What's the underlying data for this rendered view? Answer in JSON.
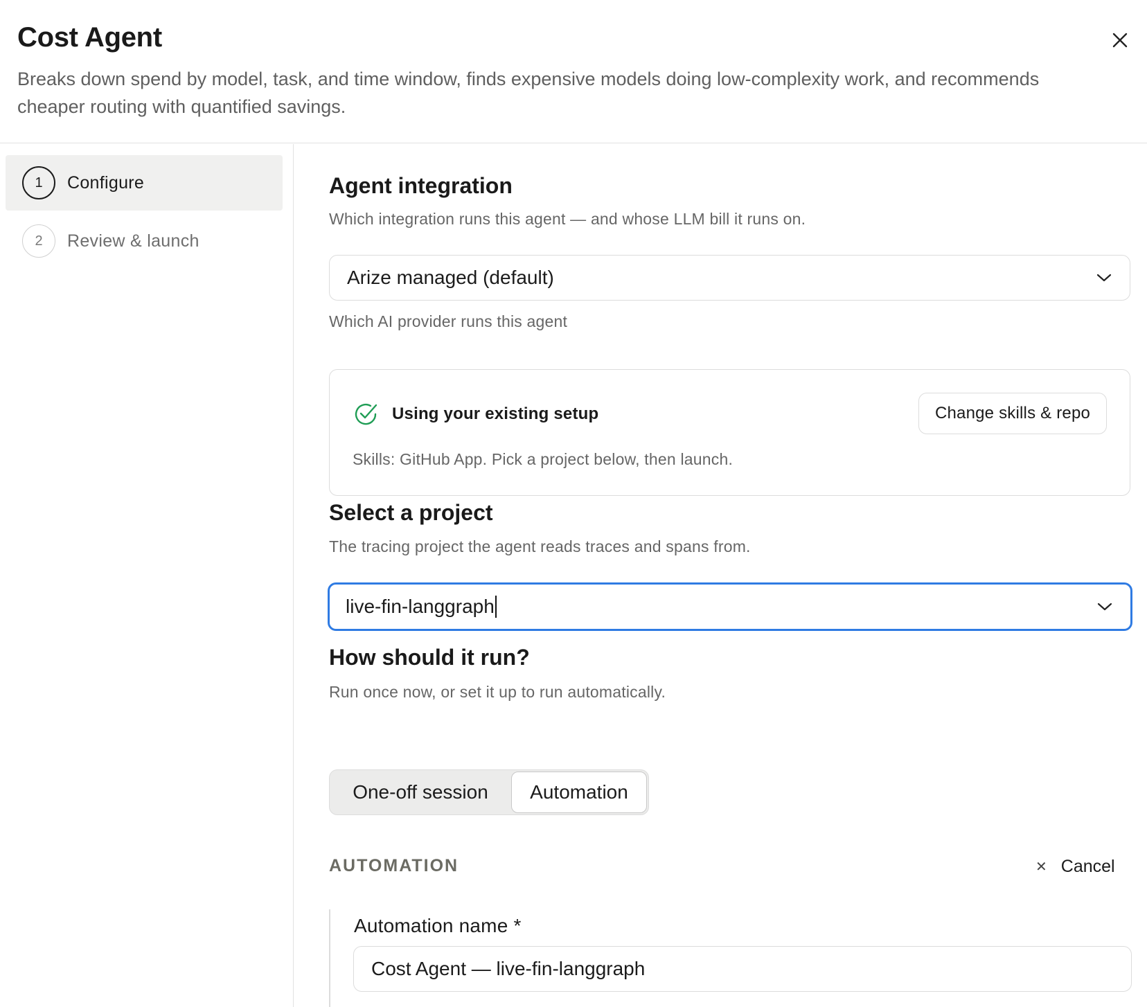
{
  "header": {
    "title": "Cost Agent",
    "subtitle": "Breaks down spend by model, task, and time window, finds expensive models doing low-complexity work, and recommends cheaper routing with quantified savings.",
    "close_icon": "close-icon"
  },
  "sidebar": {
    "steps": [
      {
        "number": "1",
        "label": "Configure",
        "active": true
      },
      {
        "number": "2",
        "label": "Review & launch",
        "active": false
      }
    ]
  },
  "integration": {
    "heading": "Agent integration",
    "description": "Which integration runs this agent — and whose LLM bill it runs on.",
    "selected": "Arize managed (default)",
    "help": "Which AI provider runs this agent"
  },
  "setup": {
    "title": "Using your existing setup",
    "note": "Skills: GitHub App. Pick a project below, then launch.",
    "change_button": "Change skills & repo",
    "status_color": "#1f9d55"
  },
  "project": {
    "heading": "Select a project",
    "description": "The tracing project the agent reads traces and spans from.",
    "value": "live-fin-langgraph",
    "focus_color": "#2f7be3"
  },
  "run": {
    "heading": "How should it run?",
    "description": "Run once now, or set it up to run automatically.",
    "options": [
      "One-off session",
      "Automation"
    ],
    "selected": "Automation"
  },
  "automation": {
    "section_label": "AUTOMATION",
    "cancel_label": "Cancel",
    "name_label": "Automation name *",
    "name_value": "Cost Agent — live-fin-langgraph"
  }
}
